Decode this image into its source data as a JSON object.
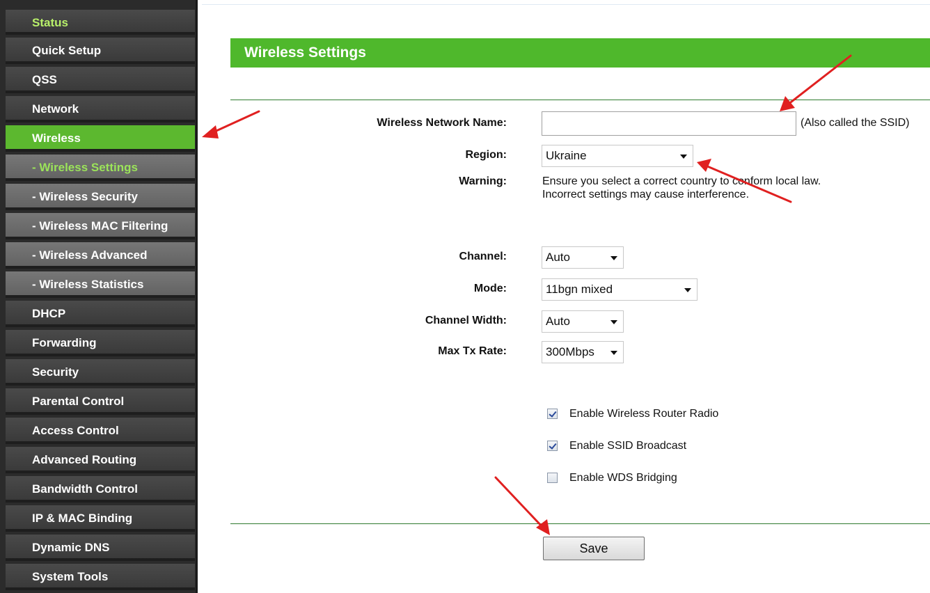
{
  "sidebar": {
    "items": [
      {
        "label": "Status"
      },
      {
        "label": "Quick Setup"
      },
      {
        "label": "QSS"
      },
      {
        "label": "Network"
      },
      {
        "label": "Wireless"
      },
      {
        "label": "- Wireless Settings"
      },
      {
        "label": "- Wireless Security"
      },
      {
        "label": "- Wireless MAC Filtering"
      },
      {
        "label": "- Wireless Advanced"
      },
      {
        "label": "- Wireless Statistics"
      },
      {
        "label": "DHCP"
      },
      {
        "label": "Forwarding"
      },
      {
        "label": "Security"
      },
      {
        "label": "Parental Control"
      },
      {
        "label": "Access Control"
      },
      {
        "label": "Advanced Routing"
      },
      {
        "label": "Bandwidth Control"
      },
      {
        "label": "IP & MAC Binding"
      },
      {
        "label": "Dynamic DNS"
      },
      {
        "label": "System Tools"
      }
    ]
  },
  "page": {
    "title": "Wireless Settings"
  },
  "form": {
    "ssid": {
      "label": "Wireless Network Name:",
      "value": "",
      "hint": "(Also called the SSID)"
    },
    "region": {
      "label": "Region:",
      "value": "Ukraine"
    },
    "warning": {
      "label": "Warning:",
      "line1": "Ensure you select a correct country to conform local law.",
      "line2": "Incorrect settings may cause interference."
    },
    "channel": {
      "label": "Channel:",
      "value": "Auto"
    },
    "mode": {
      "label": "Mode:",
      "value": "11bgn mixed"
    },
    "channel_width": {
      "label": "Channel Width:",
      "value": "Auto"
    },
    "max_tx_rate": {
      "label": "Max Tx Rate:",
      "value": "300Mbps"
    },
    "options": {
      "radio": {
        "label": "Enable Wireless Router Radio",
        "checked": true
      },
      "ssid_broadcast": {
        "label": "Enable SSID Broadcast",
        "checked": true
      },
      "wds": {
        "label": "Enable WDS Bridging",
        "checked": false
      }
    },
    "save_label": "Save"
  },
  "colors": {
    "accent_green": "#4fb82c",
    "sidebar_bg": "#2b2b2b",
    "annotation_red": "#e02020"
  }
}
